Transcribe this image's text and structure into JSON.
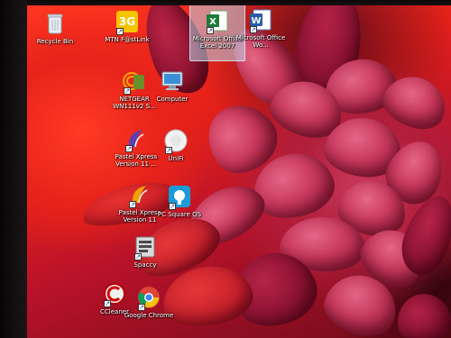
{
  "desktop": {
    "icons": [
      {
        "label": "Recycle Bin",
        "icon": "recycle-bin-icon"
      },
      {
        "label": "MTN F@stLink",
        "icon": "mtn-fastlink-icon"
      },
      {
        "label": "Microsoft Office Excel 2007",
        "icon": "excel-icon"
      },
      {
        "label": "Microsoft Office Wo...",
        "icon": "word-icon"
      },
      {
        "label": "NETGEAR WN111v2 S...",
        "icon": "netgear-icon"
      },
      {
        "label": "Computer",
        "icon": "computer-icon"
      },
      {
        "label": "Pastel Xpress Version 11 ...",
        "icon": "pastel-xpress-icon"
      },
      {
        "label": "UniFi",
        "icon": "unifi-icon"
      },
      {
        "label": "Pastel Xpress Version 11",
        "icon": "pastel-xpress-icon"
      },
      {
        "label": "PC Square QS",
        "icon": "pc-square-icon"
      },
      {
        "label": "Spaccy",
        "icon": "speccy-icon"
      },
      {
        "label": "CCleaner",
        "icon": "ccleaner-icon"
      },
      {
        "label": "Google Chrome",
        "icon": "chrome-icon"
      }
    ]
  },
  "colors": {
    "wallpaper_red": "#e3201a",
    "flower_pink": "#c93a5e",
    "selection": "#bed7eb"
  }
}
